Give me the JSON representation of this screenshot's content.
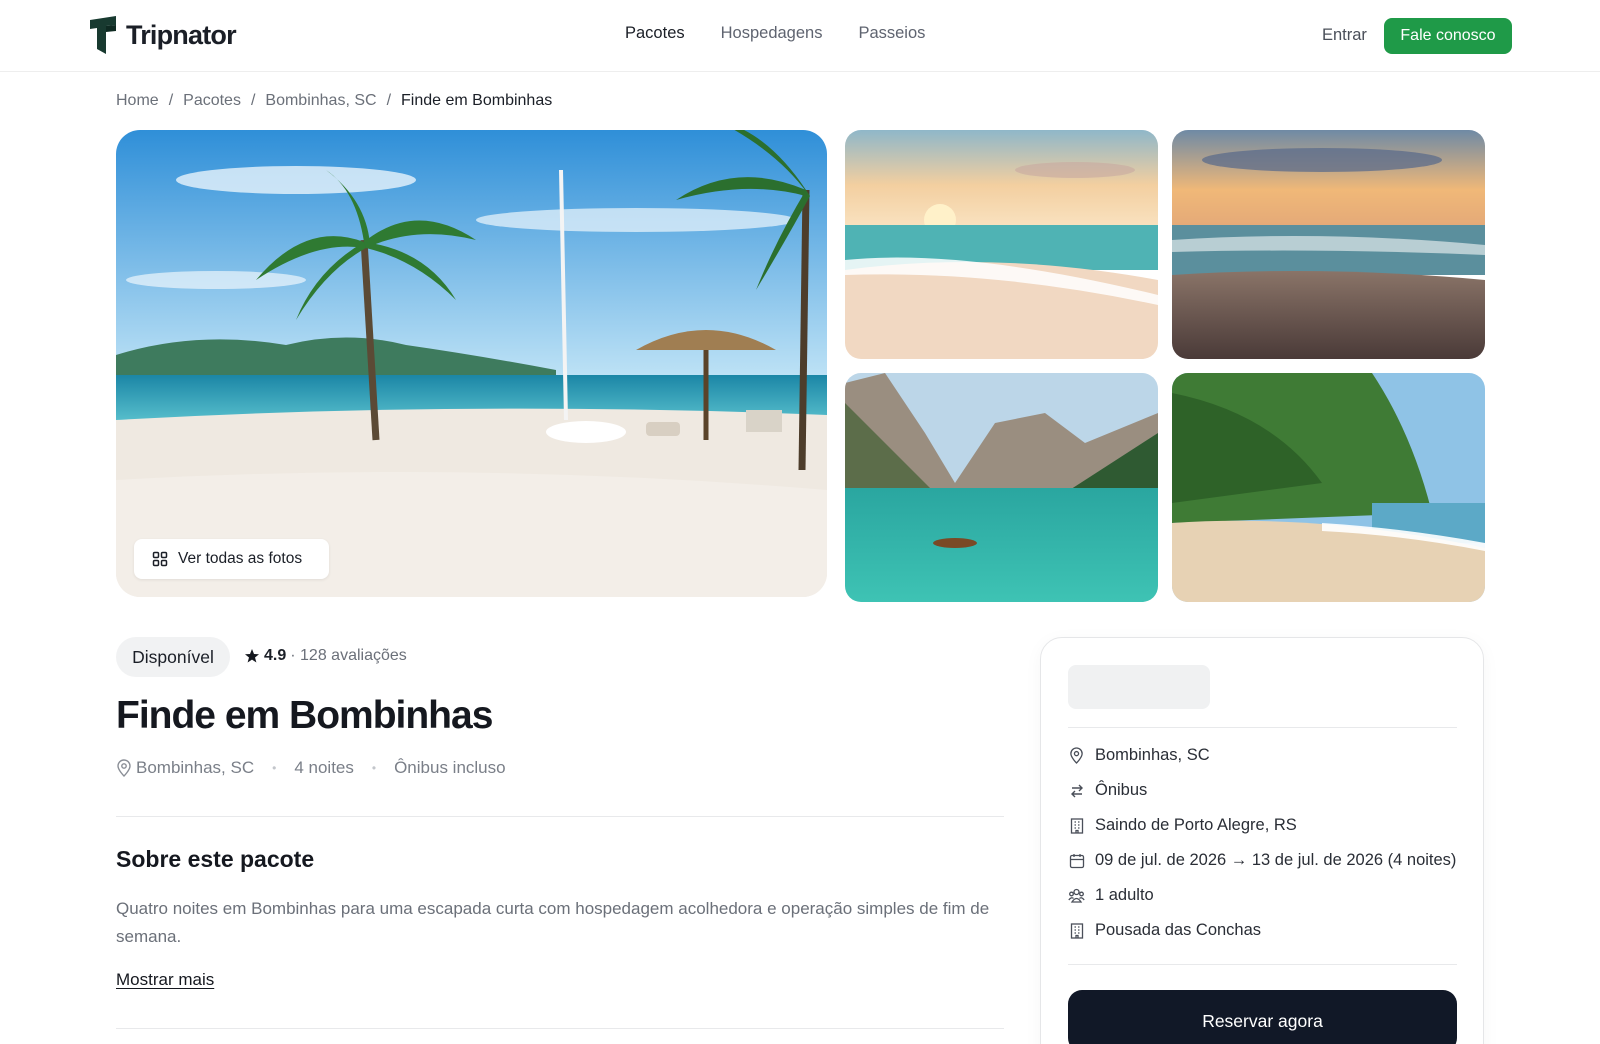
{
  "header": {
    "brand": "Tripnator",
    "nav": [
      {
        "label": "Pacotes",
        "active": true
      },
      {
        "label": "Hospedagens",
        "active": false
      },
      {
        "label": "Passeios",
        "active": false
      }
    ],
    "login_label": "Entrar",
    "contact_label": "Fale conosco"
  },
  "breadcrumb": [
    "Home",
    "Pacotes",
    "Bombinhas, SC",
    "Finde em Bombinhas"
  ],
  "gallery": {
    "view_all_label": "Ver todas as fotos",
    "photos": [
      "beach-palm-umbrella",
      "sunset-beach-waves",
      "sunset-dark-beach",
      "mountain-lake-boat",
      "tropical-palm-beach"
    ]
  },
  "package": {
    "status": "Disponível",
    "rating": "4.9",
    "reviews": "· 128 avaliações",
    "title": "Finde em Bombinhas",
    "location": "Bombinhas, SC",
    "nights": "4 noites",
    "transport": "Ônibus incluso",
    "about_title": "Sobre este pacote",
    "description": "Quatro noites em Bombinhas para uma escapada curta com hospedagem acolhedora e operação simples de fim de semana.",
    "show_more": "Mostrar mais"
  },
  "booking": {
    "rows": [
      {
        "icon": "map-pin-icon",
        "text": "Bombinhas, SC"
      },
      {
        "icon": "transfer-icon",
        "text": "Ônibus"
      },
      {
        "icon": "building-icon",
        "text": "Saindo de Porto Alegre, RS"
      },
      {
        "icon": "calendar-icon",
        "text": "09 de jul. de 2026 → 13 de jul. de 2026 (4 noites)"
      },
      {
        "icon": "users-icon",
        "text": "1 adulto"
      },
      {
        "icon": "hotel-icon",
        "text": "Pousada das Conchas"
      }
    ],
    "reserve_label": "Reservar agora"
  },
  "colors": {
    "accent": "#1f9a48",
    "primary_dark": "#111827",
    "text": "#1b1f27",
    "muted": "#6b7079"
  }
}
